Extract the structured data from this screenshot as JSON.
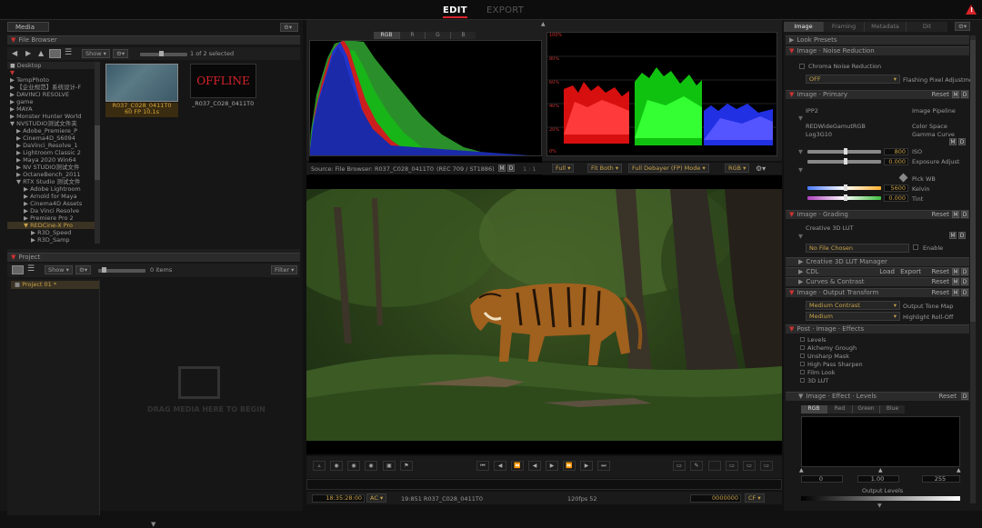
{
  "topbar": {
    "edit": "EDIT",
    "export": "EXPORT",
    "warning": "!"
  },
  "left": {
    "media_tab": "Media",
    "file_browser": {
      "title": "File Browser",
      "show": "Show",
      "selection": "1 of 2 selected",
      "tree": [
        "Desktop",
        "",
        "TempPhoto",
        "【企业规范】系统设计-F",
        "DAVINCI RESOLVE",
        "game",
        "MAYA",
        "Monster Hunter World",
        "NVSTUDIO测试文件夹",
        "Adobe_Premiere_P",
        "Cinema4D_S6094",
        "DaVinci_Resolve_1",
        "Lightroom Classic 2",
        "Maya 2020 Win64",
        "NV STUDIO测试文件",
        "OctaneBench_2011",
        "RTX Studio 测试文件",
        "Adobe Lightroom",
        "Arnold for Maya",
        "Cinema4D Assets",
        "Da Vinci Resolve",
        "Premiere Pro 2",
        "REDCine-X Pro",
        "R3D_Speed",
        "R3D_Samp"
      ],
      "clip1_name": "R037_C028_0411T0",
      "clip1_fps": "60 FP  10.1s",
      "clip2_offline": "OFFLINE",
      "clip2_name": "_R037_C028_0411T0"
    },
    "project": {
      "title": "Project",
      "show": "Show",
      "items_count": "0 items",
      "filter": "Filter",
      "project_item": "Project 01 *",
      "drop_text": "DRAG MEDIA HERE TO BEGIN"
    }
  },
  "scopes": {
    "histo_tabs": [
      "RGB",
      "R",
      "G",
      "B"
    ],
    "wave_labels": [
      "100%",
      "80%",
      "60%",
      "40%",
      "20%",
      "0%"
    ]
  },
  "viewer": {
    "source": "Source: File Browser: R037_C028_0411T0",
    "colorspace": "(REC 709 / ST1886)",
    "m": "M",
    "d": "D",
    "zoom": "1 : 1",
    "fit": "Full",
    "fitboth": "Fit Both",
    "debayer": "Full Debayer (FP) Mode",
    "rgb": "RGB"
  },
  "timeline": {
    "timecode": "18:35:28:00",
    "ac": "AC",
    "clip_tc": "19:851 R037_C028_0411T0",
    "fps": "120fps  52",
    "frame": "0000000",
    "cf": "CF"
  },
  "right": {
    "tabs": [
      "Image",
      "Framing",
      "Metadata",
      "Dit"
    ],
    "look_presets": "Look Presets",
    "noise": {
      "title": "Image · Noise Reduction",
      "chroma": "Chroma Noise Reduction",
      "off": "OFF",
      "flashing": "Flashing Pixel Adjustme"
    },
    "primary": {
      "title": "Image · Primary",
      "reset": "Reset",
      "ipp2": "IPP2",
      "image_pipeline": "Image Pipeline",
      "redwide": "REDWideGamutRGB",
      "color_space": "Color Space",
      "log3g10": "Log3G10",
      "gamma_curve": "Gamma Curve",
      "iso_val": "800",
      "iso": "ISO",
      "exposure_val": "0.000",
      "exposure": "Exposure Adjust",
      "pick_wb": "Pick WB",
      "kelvin_val": "5600",
      "kelvin": "Kelvin",
      "tint_val": "0.000",
      "tint": "Tint"
    },
    "grading": {
      "title": "Image · Grading",
      "reset": "Reset",
      "creative_lut": "Creative 3D LUT",
      "no_file": "No File Chosen",
      "enable": "Enable",
      "lut_manager": "Creative 3D LUT Manager",
      "cdl": "CDL",
      "load": "Load",
      "export": "Export",
      "curves": "Curves & Contrast"
    },
    "output": {
      "title": "Image · Output Transform",
      "reset": "Reset",
      "medium_contrast": "Medium Contrast",
      "tone_map": "Output Tone Map",
      "medium": "Medium",
      "highlight": "Highlight Roll-Off"
    },
    "effects": {
      "title": "Post · Image · Effects",
      "items": [
        "Levels",
        "Alchemy Grough",
        "Unsharp Mask",
        "High Pass Sharpen",
        "Film Look",
        "3D LUT"
      ]
    },
    "levels": {
      "title": "Image · Effect · Levels",
      "reset": "Reset",
      "d": "D",
      "tabs": [
        "RGB",
        "Red",
        "Green",
        "Blue"
      ],
      "low": "0",
      "mid": "1.00",
      "high": "255",
      "output": "Output Levels"
    }
  }
}
